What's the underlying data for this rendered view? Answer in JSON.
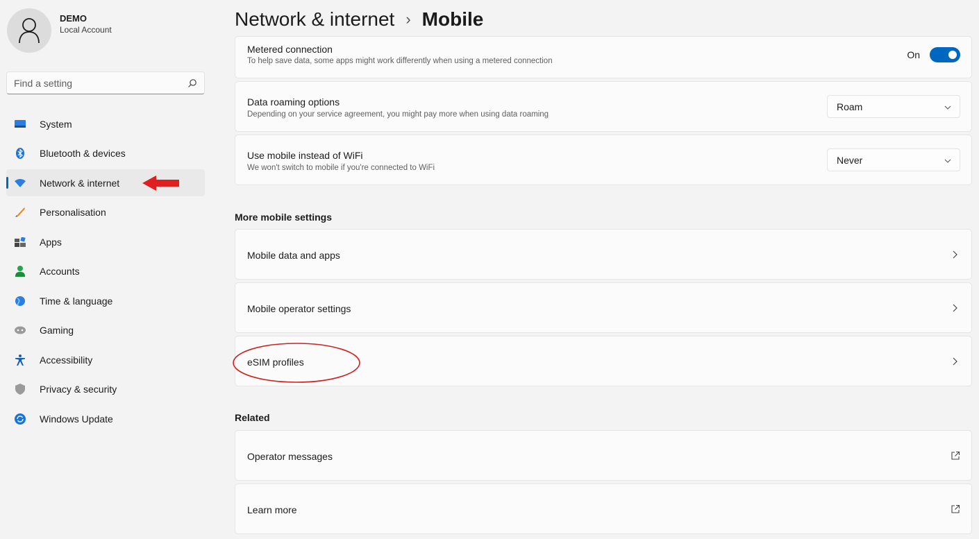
{
  "profile": {
    "name": "DEMO",
    "account_type": "Local Account",
    "icon": "person-icon"
  },
  "search": {
    "placeholder": "Find a setting",
    "icon": "search-icon"
  },
  "nav": [
    {
      "label": "System",
      "icon": "system-icon"
    },
    {
      "label": "Bluetooth & devices",
      "icon": "bluetooth-icon"
    },
    {
      "label": "Network & internet",
      "icon": "wifi-icon",
      "active": true
    },
    {
      "label": "Personalisation",
      "icon": "brush-icon"
    },
    {
      "label": "Apps",
      "icon": "apps-icon"
    },
    {
      "label": "Accounts",
      "icon": "accounts-icon"
    },
    {
      "label": "Time & language",
      "icon": "globe-icon"
    },
    {
      "label": "Gaming",
      "icon": "gamepad-icon"
    },
    {
      "label": "Accessibility",
      "icon": "accessibility-icon"
    },
    {
      "label": "Privacy & security",
      "icon": "shield-icon"
    },
    {
      "label": "Windows Update",
      "icon": "update-icon"
    }
  ],
  "breadcrumb": {
    "parent": "Network & internet",
    "separator": "›",
    "current": "Mobile"
  },
  "settings": {
    "metered": {
      "label": "Metered connection",
      "description": "To help save data, some apps might work differently when using a metered connection",
      "toggle_text": "On",
      "toggle_on": true
    },
    "roaming": {
      "label": "Data roaming options",
      "description": "Depending on your service agreement, you might pay more when using data roaming",
      "value": "Roam"
    },
    "mobile_wifi": {
      "label": "Use mobile instead of WiFi",
      "description": "We won't switch to mobile if you're connected to WiFi",
      "value": "Never"
    }
  },
  "more_section": {
    "title": "More mobile settings",
    "items": [
      "Mobile data and apps",
      "Mobile operator settings",
      "eSIM profiles"
    ]
  },
  "related_section": {
    "title": "Related",
    "items": [
      "Operator messages",
      "Learn more"
    ]
  },
  "colors": {
    "accent": "#0067c0",
    "annotation": "#e02020",
    "background": "#f3f3f3",
    "card": "#fbfbfb"
  }
}
